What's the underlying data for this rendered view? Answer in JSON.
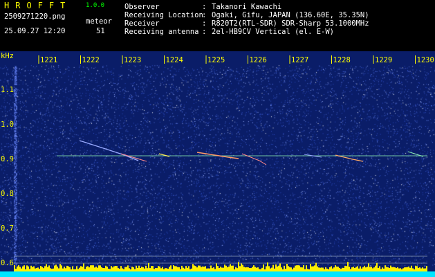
{
  "header": {
    "logo": "HROFFT",
    "version": "1.0.0",
    "filename": "2509271220.png",
    "datetime": "25.09.27 12:20",
    "meteor_label": "meteor",
    "meteor_count": "51",
    "observer_label": "Observer",
    "observer_value": "Takanori Kawachi",
    "location_label": "Receiving Location",
    "location_value": "Ogaki, Gifu, JAPAN (136.60E, 35.35N)",
    "receiver_label": "Receiver",
    "receiver_value": "R820T2(RTL-SDR) SDR-Sharp 53.1000MHz",
    "antenna_label": "Receiving antenna",
    "antenna_value": "2el-HB9CV Vertical (el. E-W)",
    "separator": ":"
  },
  "spectrogram": {
    "y_unit": "kHz",
    "y_ticks": [
      {
        "label": "1.1",
        "value": 1.1
      },
      {
        "label": "1.0",
        "value": 1.0
      },
      {
        "label": "0.9",
        "value": 0.9
      },
      {
        "label": "0.8",
        "value": 0.8
      },
      {
        "label": "0.7",
        "value": 0.7
      },
      {
        "label": "0.6",
        "value": 0.6
      }
    ],
    "x_ticks": [
      "1221",
      "1222",
      "1223",
      "1224",
      "1225",
      "1226",
      "1227",
      "1228",
      "1229",
      "1230"
    ],
    "carrier_freq_khz": 0.91,
    "colors": {
      "background": "#0a1d68",
      "axis_text": "#ffff00",
      "carrier": "#8cf0b0",
      "baseline": "#00e5ff",
      "bars": "#ffee00"
    }
  }
}
